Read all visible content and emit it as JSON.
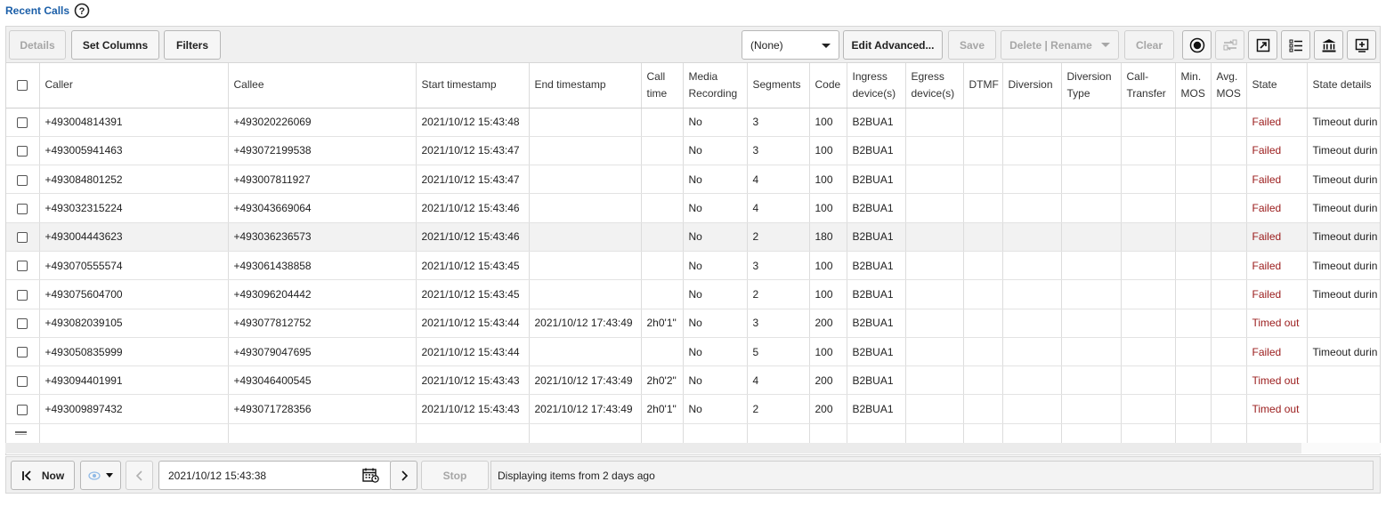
{
  "page": {
    "title": "Recent Calls"
  },
  "toolbar": {
    "details": "Details",
    "set_columns": "Set Columns",
    "filters": "Filters",
    "view_select": "(None)",
    "edit_advanced": "Edit Advanced...",
    "save": "Save",
    "delete_rename": "Delete | Rename",
    "clear": "Clear",
    "icons": [
      "record-icon",
      "compare-icon",
      "export-icon",
      "list-icon",
      "bank-icon",
      "add-panel-icon"
    ]
  },
  "table": {
    "columns": [
      "Caller",
      "Callee",
      "Start timestamp",
      "End timestamp",
      "Call time",
      "Media Recording",
      "Segments",
      "Code",
      "Ingress device(s)",
      "Egress device(s)",
      "DTMF",
      "Diversion",
      "Diversion Type",
      "Call-Transfer",
      "Min. MOS",
      "Avg. MOS",
      "State",
      "State details"
    ],
    "rows": [
      [
        "+493004814391",
        "+493020226069",
        "2021/10/12 15:43:48",
        "",
        "",
        "No",
        "3",
        "100",
        "B2BUA1",
        "",
        "",
        "",
        "",
        "",
        "",
        "",
        "Failed",
        "Timeout durin"
      ],
      [
        "+493005941463",
        "+493072199538",
        "2021/10/12 15:43:47",
        "",
        "",
        "No",
        "3",
        "100",
        "B2BUA1",
        "",
        "",
        "",
        "",
        "",
        "",
        "",
        "Failed",
        "Timeout durin"
      ],
      [
        "+493084801252",
        "+493007811927",
        "2021/10/12 15:43:47",
        "",
        "",
        "No",
        "4",
        "100",
        "B2BUA1",
        "",
        "",
        "",
        "",
        "",
        "",
        "",
        "Failed",
        "Timeout durin"
      ],
      [
        "+493032315224",
        "+493043669064",
        "2021/10/12 15:43:46",
        "",
        "",
        "No",
        "4",
        "100",
        "B2BUA1",
        "",
        "",
        "",
        "",
        "",
        "",
        "",
        "Failed",
        "Timeout durin"
      ],
      [
        "+493004443623",
        "+493036236573",
        "2021/10/12 15:43:46",
        "",
        "",
        "No",
        "2",
        "180",
        "B2BUA1",
        "",
        "",
        "",
        "",
        "",
        "",
        "",
        "Failed",
        "Timeout durin"
      ],
      [
        "+493070555574",
        "+493061438858",
        "2021/10/12 15:43:45",
        "",
        "",
        "No",
        "3",
        "100",
        "B2BUA1",
        "",
        "",
        "",
        "",
        "",
        "",
        "",
        "Failed",
        "Timeout durin"
      ],
      [
        "+493075604700",
        "+493096204442",
        "2021/10/12 15:43:45",
        "",
        "",
        "No",
        "2",
        "100",
        "B2BUA1",
        "",
        "",
        "",
        "",
        "",
        "",
        "",
        "Failed",
        "Timeout durin"
      ],
      [
        "+493082039105",
        "+493077812752",
        "2021/10/12 15:43:44",
        "2021/10/12 17:43:49",
        "2h0'1\"",
        "No",
        "3",
        "200",
        "B2BUA1",
        "",
        "",
        "",
        "",
        "",
        "",
        "",
        "Timed out",
        ""
      ],
      [
        "+493050835999",
        "+493079047695",
        "2021/10/12 15:43:44",
        "",
        "",
        "No",
        "5",
        "100",
        "B2BUA1",
        "",
        "",
        "",
        "",
        "",
        "",
        "",
        "Failed",
        "Timeout durin"
      ],
      [
        "+493094401991",
        "+493046400545",
        "2021/10/12 15:43:43",
        "2021/10/12 17:43:49",
        "2h0'2\"",
        "No",
        "4",
        "200",
        "B2BUA1",
        "",
        "",
        "",
        "",
        "",
        "",
        "",
        "Timed out",
        ""
      ],
      [
        "+493009897432",
        "+493071728356",
        "2021/10/12 15:43:43",
        "2021/10/12 17:43:49",
        "2h0'1\"",
        "No",
        "2",
        "200",
        "B2BUA1",
        "",
        "",
        "",
        "",
        "",
        "",
        "",
        "Timed out",
        ""
      ]
    ]
  },
  "bottom": {
    "now": "Now",
    "datetime": "2021/10/12 15:43:38",
    "stop": "Stop",
    "status": "Displaying items from 2 days ago"
  }
}
